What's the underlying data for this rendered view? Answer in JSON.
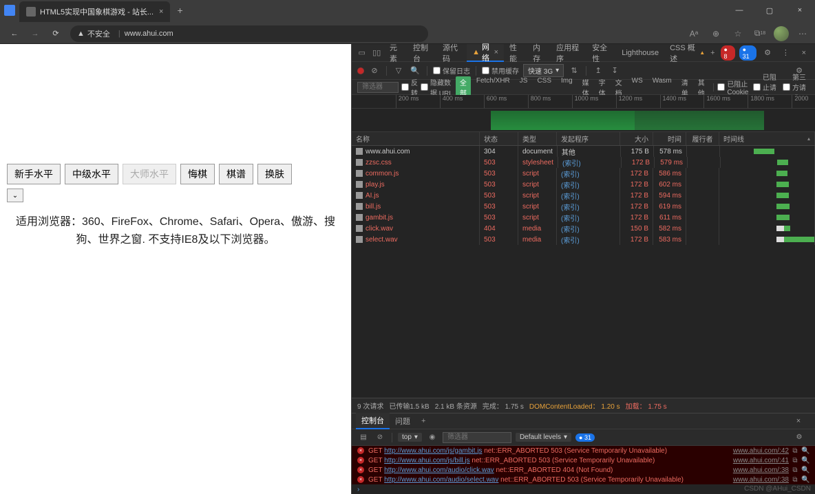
{
  "browser": {
    "tab_title": "HTML5实现中国象棋游戏 - 站长...",
    "insecure_label": "不安全",
    "url": "www.ahui.com",
    "a11y_badge": "A",
    "ext_badge": "18"
  },
  "page": {
    "buttons": [
      "新手水平",
      "中级水平",
      "大师水平",
      "悔棋",
      "棋谱",
      "换肤"
    ],
    "disabled_index": 2,
    "desc": "适用浏览器：360、FireFox、Chrome、Safari、Opera、傲游、搜狗、世界之窗. 不支持IE8及以下浏览器。"
  },
  "devtools": {
    "tabs": [
      "元素",
      "控制台",
      "源代码",
      "网络",
      "性能",
      "内存",
      "应用程序",
      "安全性",
      "Lighthouse",
      "CSS 概述"
    ],
    "active_tab": 3,
    "network_warning": "▲",
    "err_badge": "8",
    "info_badge": "31",
    "net_toolbar": {
      "preserve_log": "保留日志",
      "disable_cache": "禁用缓存",
      "throttle": "快速 3G"
    },
    "filter_placeholder": "筛选器",
    "filter_invert": "反转",
    "filter_hide_data": "隐藏数据 URL",
    "filter_types": [
      "全部",
      "Fetch/XHR",
      "JS",
      "CSS",
      "Img",
      "媒体",
      "字体",
      "文档",
      "WS",
      "Wasm",
      "清单",
      "其他"
    ],
    "filter_blocked_cookie": "已阻止 Cookie",
    "filter_blocked_req": "已阻止请求",
    "filter_third_party": "第三方请求",
    "ruler": [
      "200 ms",
      "400 ms",
      "600 ms",
      "800 ms",
      "1000 ms",
      "1200 ms",
      "1400 ms",
      "1600 ms",
      "1800 ms",
      "2000"
    ],
    "columns": [
      "名称",
      "状态",
      "类型",
      "发起程序",
      "大小",
      "时间",
      "履行者",
      "时间线"
    ],
    "rows": [
      {
        "name": "www.ahui.com",
        "status": "304",
        "type": "document",
        "init": "其他",
        "size": "175 B",
        "time": "578 ms",
        "err": false,
        "wf": [
          36,
          58,
          "green"
        ]
      },
      {
        "name": "zzsc.css",
        "status": "503",
        "type": "stylesheet",
        "init": "(索引)",
        "size": "172 B",
        "time": "579 ms",
        "err": true,
        "wf": [
          60,
          72,
          "green"
        ]
      },
      {
        "name": "common.js",
        "status": "503",
        "type": "script",
        "init": "(索引)",
        "size": "172 B",
        "time": "586 ms",
        "err": true,
        "wf": [
          60,
          72,
          "green"
        ]
      },
      {
        "name": "play.js",
        "status": "503",
        "type": "script",
        "init": "(索引)",
        "size": "172 B",
        "time": "602 ms",
        "err": true,
        "wf": [
          60,
          73,
          "green"
        ]
      },
      {
        "name": "AI.js",
        "status": "503",
        "type": "script",
        "init": "(索引)",
        "size": "172 B",
        "time": "594 ms",
        "err": true,
        "wf": [
          60,
          73,
          "green"
        ]
      },
      {
        "name": "bill.js",
        "status": "503",
        "type": "script",
        "init": "(索引)",
        "size": "172 B",
        "time": "619 ms",
        "err": true,
        "wf": [
          60,
          74,
          "green"
        ]
      },
      {
        "name": "gambit.js",
        "status": "503",
        "type": "script",
        "init": "(索引)",
        "size": "172 B",
        "time": "611 ms",
        "err": true,
        "wf": [
          60,
          74,
          "green"
        ]
      },
      {
        "name": "click.wav",
        "status": "404",
        "type": "media",
        "init": "(索引)",
        "size": "150 B",
        "time": "582 ms",
        "err": true,
        "wf": [
          60,
          68,
          "white",
          68,
          75,
          "green"
        ]
      },
      {
        "name": "select.wav",
        "status": "503",
        "type": "media",
        "init": "(索引)",
        "size": "172 B",
        "time": "583 ms",
        "err": true,
        "wf": [
          60,
          68,
          "white",
          68,
          100,
          "green"
        ]
      }
    ],
    "summary": {
      "req": "9 次请求",
      "trans": "已传输1.5 kB",
      "res": "2.1 kB 条资源",
      "finish_label": "完成：",
      "finish": "1.75 s",
      "dcl_label": "DOMContentLoaded：",
      "dcl": "1.20 s",
      "load_label": "加载：",
      "load": "1.75 s"
    },
    "console": {
      "tabs": [
        "控制台",
        "问题"
      ],
      "ctx": "top",
      "levels": "Default levels",
      "issue_badge": "31",
      "rows": [
        {
          "method": "GET",
          "url": "http://www.ahui.com/js/gambit.js",
          "msg": "net::ERR_ABORTED 503 (Service Temporarily Unavailable)",
          "src": "www.ahui.com/:42"
        },
        {
          "method": "GET",
          "url": "http://www.ahui.com/js/bill.js",
          "msg": "net::ERR_ABORTED 503 (Service Temporarily Unavailable)",
          "src": "www.ahui.com/:41"
        },
        {
          "method": "GET",
          "url": "http://www.ahui.com/audio/click.wav",
          "msg": "net::ERR_ABORTED 404 (Not Found)",
          "src": "www.ahui.com/:38"
        },
        {
          "method": "GET",
          "url": "http://www.ahui.com/audio/select.wav",
          "msg": "net::ERR_ABORTED 503 (Service Temporarily Unavailable)",
          "src": "www.ahui.com/:38"
        }
      ]
    }
  },
  "watermark": "CSDN @AHui_CSDN"
}
